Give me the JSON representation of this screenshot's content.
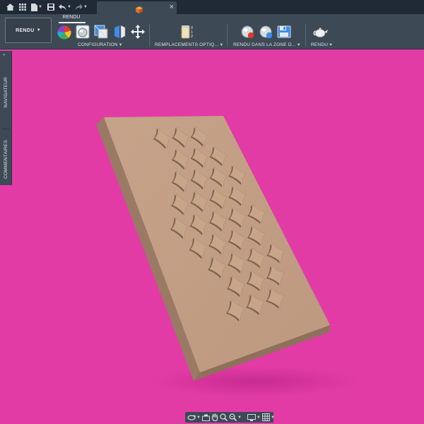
{
  "title_bar": {
    "icons": [
      "home-icon",
      "grid-icon",
      "file-icon",
      "save-icon",
      "undo-icon",
      "redo-icon",
      "cube-icon",
      "close-icon"
    ],
    "document_tab": {
      "close_glyph": "×"
    }
  },
  "ribbon": {
    "workspace_button": {
      "label": "RENDU"
    },
    "active_tab": "RENDU",
    "groups": [
      {
        "label": "CONFIGURATION",
        "icons": [
          "appearance-icon",
          "scene-settings-icon",
          "texture-map-icon",
          "decal-icon",
          "move-icon"
        ]
      },
      {
        "label": "REMPLACEMENTS OPTIQ...",
        "icons": [
          "physical-material-icon"
        ]
      },
      {
        "label": "RENDU DANS LA ZONE D...",
        "icons": [
          "in-canvas-render-icon",
          "render-settings-icon",
          "capture-image-icon"
        ]
      },
      {
        "label": "RENDU",
        "icons": [
          "render-teapot-icon"
        ]
      }
    ]
  },
  "left_panel": {
    "tabs": [
      {
        "label": "NAVIGATEUR"
      },
      {
        "label": "COMMENTAIRES"
      }
    ]
  },
  "nav_bar": {
    "icons": [
      "orbit-icon",
      "look-at-icon",
      "pan-icon",
      "zoom-icon",
      "fit-icon",
      "display-settings-icon",
      "grid-settings-icon"
    ]
  },
  "colors": {
    "background": "#e33ba6",
    "chrome": "#3d4955",
    "titlebar": "#1f2a36",
    "panel_face": "#c49f85",
    "panel_edge": "#9c7c66"
  }
}
